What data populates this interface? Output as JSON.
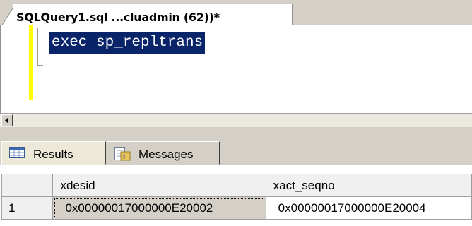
{
  "editor_tab": {
    "title": "SQLQuery1.sql ...cluadmin (62))*"
  },
  "editor": {
    "code_lines": [
      "exec sp_repltrans"
    ]
  },
  "result_tabs": [
    {
      "label": "Results",
      "icon": "grid-icon",
      "selected": true
    },
    {
      "label": "Messages",
      "icon": "messages-icon",
      "selected": false
    }
  ],
  "grid": {
    "columns": [
      "xdesid",
      "xact_seqno"
    ],
    "rows": [
      {
        "row_number": "1",
        "cells": [
          "0x00000017000000E20002",
          "0x00000017000000E20004"
        ]
      }
    ]
  },
  "colors": {
    "selection": "#0a246a",
    "change_bar": "#ffff00",
    "chrome": "#d4d0c8"
  }
}
